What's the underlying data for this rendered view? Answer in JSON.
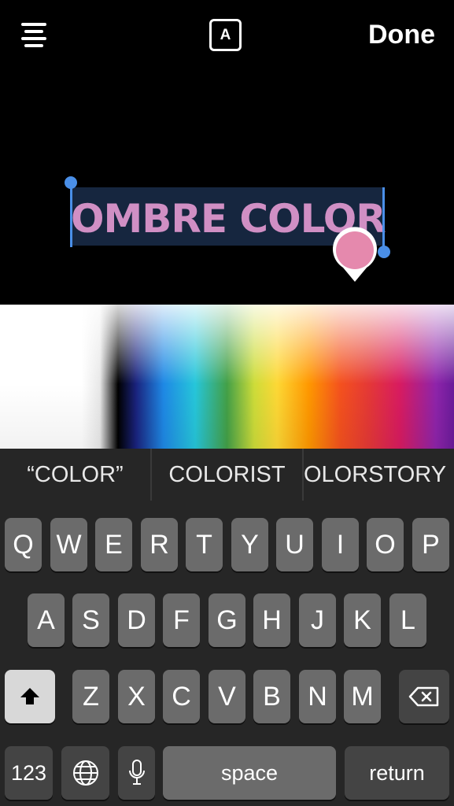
{
  "toolbar": {
    "font_label": "A",
    "done_label": "Done"
  },
  "editor": {
    "text": "OMBRE COLOR",
    "text_color": "#d08fc4",
    "selection_color": "#4a8fe8",
    "picker_pin_color": "#e589ad"
  },
  "suggestions": [
    "“COLOR”",
    "COLORIST",
    "OLORSTORY"
  ],
  "keyboard": {
    "row1": [
      "Q",
      "W",
      "E",
      "R",
      "T",
      "Y",
      "U",
      "I",
      "O",
      "P"
    ],
    "row2": [
      "A",
      "S",
      "D",
      "F",
      "G",
      "H",
      "J",
      "K",
      "L"
    ],
    "row3": [
      "Z",
      "X",
      "C",
      "V",
      "B",
      "N",
      "M"
    ],
    "numbers_label": "123",
    "space_label": "space",
    "return_label": "return",
    "shift_icon": "shift-icon",
    "delete_icon": "delete-icon",
    "globe_icon": "globe-icon",
    "mic_icon": "microphone-icon"
  }
}
